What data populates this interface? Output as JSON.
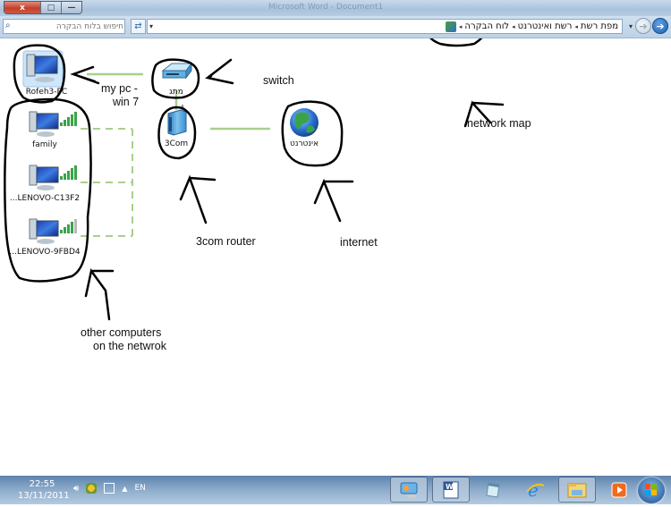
{
  "window": {
    "title": "Microsoft Word - Document1",
    "buttons": {
      "close": "x",
      "maximize": "□",
      "minimize": "—"
    }
  },
  "address_bar": {
    "search_placeholder": "חיפוש בלוח הבקרה",
    "search_icon": "search-icon",
    "refresh_icon": "refresh-icon",
    "dropdown_icon": "chevron-down-icon",
    "breadcrumbs": [
      "לוח הבקרה",
      "רשת ואינטרנט",
      "מפת רשת"
    ],
    "nav": {
      "back": "back-arrow-icon",
      "forward": "forward-arrow-icon"
    }
  },
  "network_map": {
    "nodes": {
      "my_pc": {
        "name": "Rofeh3-PC",
        "icon": "computer-icon"
      },
      "switch": {
        "name": "מתג",
        "icon": "switch-icon"
      },
      "router": {
        "name": "3Com",
        "icon": "router-icon"
      },
      "internet": {
        "name": "אינטרנט",
        "icon": "globe-icon"
      },
      "computers": [
        {
          "name": "family",
          "icon": "computer-icon",
          "signal_bars": 5,
          "signal_strength": "5/5"
        },
        {
          "name": "...LENOVO-C13F2",
          "icon": "computer-icon",
          "signal_bars": 5,
          "signal_strength": "5/5"
        },
        {
          "name": "...LENOVO-9FBD4",
          "icon": "computer-icon",
          "signal_bars": 5,
          "signal_strength": "4/5"
        }
      ]
    },
    "colors": {
      "wired_link": "#a8d08d",
      "wireless_link": "#a8d08d",
      "annotation_ink": "#000000"
    }
  },
  "annotations": {
    "my_pc": "my pc -\nwin 7",
    "my_pc_line1": "my pc -",
    "my_pc_line2": "win 7",
    "switch": "switch",
    "router": "3com router",
    "internet": "internet",
    "network_map": "network map",
    "others_line1": "other computers",
    "others_line2": "on the netwrok"
  },
  "taskbar": {
    "time": "22:55",
    "date": "13/11/2011",
    "language": "EN",
    "tray_icons": [
      "volume-icon",
      "action-center-icon",
      "network-icon",
      "show-hidden-icons-icon"
    ],
    "apps": [
      {
        "name": "control-panel",
        "icon": "control-panel-icon",
        "active": true
      },
      {
        "name": "word",
        "icon": "word-icon",
        "active": true
      },
      {
        "name": "notepad",
        "icon": "notepad-icon",
        "active": false
      },
      {
        "name": "internet-explorer",
        "icon": "ie-icon",
        "active": false
      },
      {
        "name": "explorer",
        "icon": "folder-icon",
        "active": true
      },
      {
        "name": "media-player",
        "icon": "media-player-icon",
        "active": false
      }
    ],
    "start": "start-orb-icon"
  }
}
